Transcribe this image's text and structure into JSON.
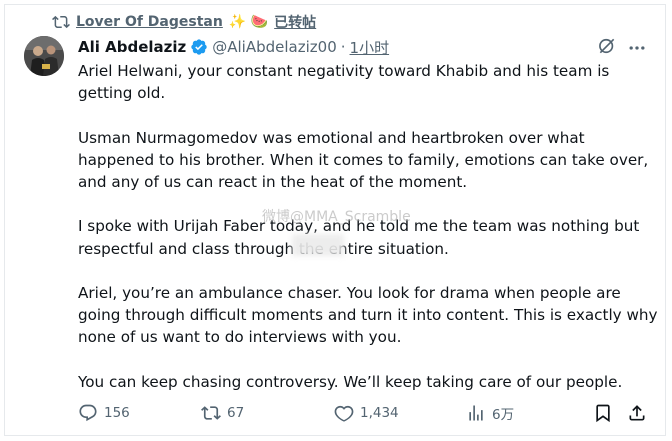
{
  "repost": {
    "user": "Lover Of Dagestan",
    "emoji": "✨ 🍉",
    "label": "已转帖"
  },
  "author": {
    "display_name": "Ali Abdelaziz",
    "handle": "@AliAbdelaziz00",
    "separator": "·",
    "time": "1小时"
  },
  "paragraphs": [
    "Ariel Helwani, your constant negativity toward Khabib and his team is getting old.",
    "Usman Nurmagomedov was emotional and heartbroken over what happened to his brother. When it comes to family, emotions can take over, and any of us can react in the heat of the moment.",
    "I spoke with Urijah Faber today, and he told me the team was nothing but respectful and class through the entire situation.",
    "Ariel, you’re an ambulance chaser. You look for drama when people are going through difficult moments and turn it into content. This is exactly why none of us want to do interviews with you.",
    "You can keep chasing controversy. We’ll keep taking care of our people."
  ],
  "watermark": "微博@MMA_Scramble",
  "actions": {
    "replies": "156",
    "reposts": "67",
    "likes": "1,434",
    "views": "6万"
  },
  "icons": {
    "repost": "repost-icon",
    "verified": "verified-badge-icon",
    "grok": "grok-icon",
    "more": "more-icon",
    "reply": "reply-icon",
    "like": "heart-icon",
    "views": "views-icon",
    "bookmark": "bookmark-icon",
    "share": "share-icon"
  },
  "colors": {
    "text": "#0f1419",
    "muted": "#536471",
    "verified": "#1d9bf0",
    "border": "#e6e9ec"
  }
}
